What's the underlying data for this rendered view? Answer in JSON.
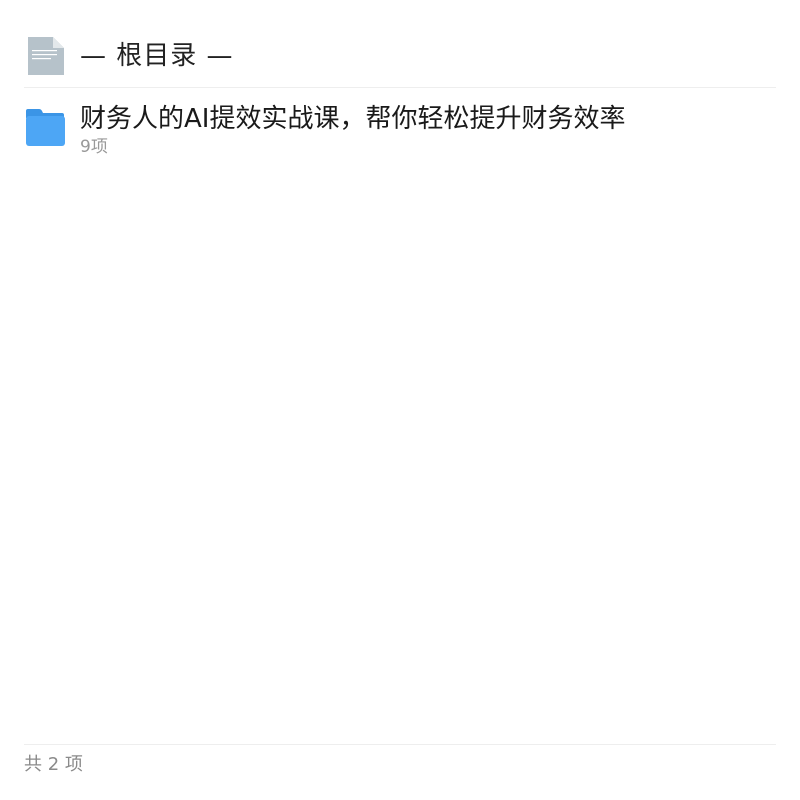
{
  "header": {
    "icon": "document-icon",
    "title": "— 根目录 —"
  },
  "items": [
    {
      "icon": "folder-icon",
      "name": "财务人的AI提效实战课，帮你轻松提升财务效率",
      "meta": "9项"
    }
  ],
  "footer": {
    "count_text": "共 2 项"
  },
  "colors": {
    "folder": "#4da6f5",
    "folder_tab": "#3b95e6",
    "document": "#b6c2ca",
    "title_text": "#1a1a1a",
    "meta_text": "#999999"
  }
}
